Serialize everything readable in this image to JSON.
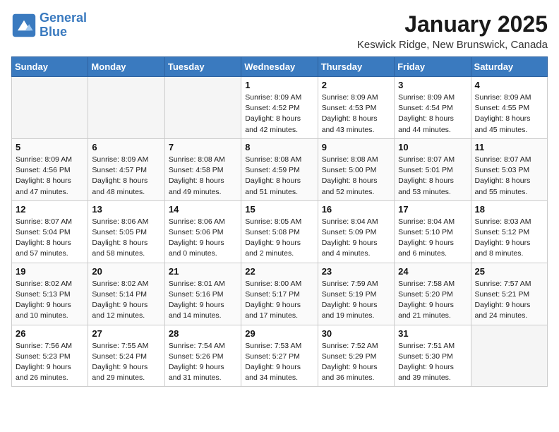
{
  "header": {
    "logo_line1": "General",
    "logo_line2": "Blue",
    "month_title": "January 2025",
    "location": "Keswick Ridge, New Brunswick, Canada"
  },
  "weekdays": [
    "Sunday",
    "Monday",
    "Tuesday",
    "Wednesday",
    "Thursday",
    "Friday",
    "Saturday"
  ],
  "weeks": [
    [
      {
        "day": "",
        "info": ""
      },
      {
        "day": "",
        "info": ""
      },
      {
        "day": "",
        "info": ""
      },
      {
        "day": "1",
        "info": "Sunrise: 8:09 AM\nSunset: 4:52 PM\nDaylight: 8 hours\nand 42 minutes."
      },
      {
        "day": "2",
        "info": "Sunrise: 8:09 AM\nSunset: 4:53 PM\nDaylight: 8 hours\nand 43 minutes."
      },
      {
        "day": "3",
        "info": "Sunrise: 8:09 AM\nSunset: 4:54 PM\nDaylight: 8 hours\nand 44 minutes."
      },
      {
        "day": "4",
        "info": "Sunrise: 8:09 AM\nSunset: 4:55 PM\nDaylight: 8 hours\nand 45 minutes."
      }
    ],
    [
      {
        "day": "5",
        "info": "Sunrise: 8:09 AM\nSunset: 4:56 PM\nDaylight: 8 hours\nand 47 minutes."
      },
      {
        "day": "6",
        "info": "Sunrise: 8:09 AM\nSunset: 4:57 PM\nDaylight: 8 hours\nand 48 minutes."
      },
      {
        "day": "7",
        "info": "Sunrise: 8:08 AM\nSunset: 4:58 PM\nDaylight: 8 hours\nand 49 minutes."
      },
      {
        "day": "8",
        "info": "Sunrise: 8:08 AM\nSunset: 4:59 PM\nDaylight: 8 hours\nand 51 minutes."
      },
      {
        "day": "9",
        "info": "Sunrise: 8:08 AM\nSunset: 5:00 PM\nDaylight: 8 hours\nand 52 minutes."
      },
      {
        "day": "10",
        "info": "Sunrise: 8:07 AM\nSunset: 5:01 PM\nDaylight: 8 hours\nand 53 minutes."
      },
      {
        "day": "11",
        "info": "Sunrise: 8:07 AM\nSunset: 5:03 PM\nDaylight: 8 hours\nand 55 minutes."
      }
    ],
    [
      {
        "day": "12",
        "info": "Sunrise: 8:07 AM\nSunset: 5:04 PM\nDaylight: 8 hours\nand 57 minutes."
      },
      {
        "day": "13",
        "info": "Sunrise: 8:06 AM\nSunset: 5:05 PM\nDaylight: 8 hours\nand 58 minutes."
      },
      {
        "day": "14",
        "info": "Sunrise: 8:06 AM\nSunset: 5:06 PM\nDaylight: 9 hours\nand 0 minutes."
      },
      {
        "day": "15",
        "info": "Sunrise: 8:05 AM\nSunset: 5:08 PM\nDaylight: 9 hours\nand 2 minutes."
      },
      {
        "day": "16",
        "info": "Sunrise: 8:04 AM\nSunset: 5:09 PM\nDaylight: 9 hours\nand 4 minutes."
      },
      {
        "day": "17",
        "info": "Sunrise: 8:04 AM\nSunset: 5:10 PM\nDaylight: 9 hours\nand 6 minutes."
      },
      {
        "day": "18",
        "info": "Sunrise: 8:03 AM\nSunset: 5:12 PM\nDaylight: 9 hours\nand 8 minutes."
      }
    ],
    [
      {
        "day": "19",
        "info": "Sunrise: 8:02 AM\nSunset: 5:13 PM\nDaylight: 9 hours\nand 10 minutes."
      },
      {
        "day": "20",
        "info": "Sunrise: 8:02 AM\nSunset: 5:14 PM\nDaylight: 9 hours\nand 12 minutes."
      },
      {
        "day": "21",
        "info": "Sunrise: 8:01 AM\nSunset: 5:16 PM\nDaylight: 9 hours\nand 14 minutes."
      },
      {
        "day": "22",
        "info": "Sunrise: 8:00 AM\nSunset: 5:17 PM\nDaylight: 9 hours\nand 17 minutes."
      },
      {
        "day": "23",
        "info": "Sunrise: 7:59 AM\nSunset: 5:19 PM\nDaylight: 9 hours\nand 19 minutes."
      },
      {
        "day": "24",
        "info": "Sunrise: 7:58 AM\nSunset: 5:20 PM\nDaylight: 9 hours\nand 21 minutes."
      },
      {
        "day": "25",
        "info": "Sunrise: 7:57 AM\nSunset: 5:21 PM\nDaylight: 9 hours\nand 24 minutes."
      }
    ],
    [
      {
        "day": "26",
        "info": "Sunrise: 7:56 AM\nSunset: 5:23 PM\nDaylight: 9 hours\nand 26 minutes."
      },
      {
        "day": "27",
        "info": "Sunrise: 7:55 AM\nSunset: 5:24 PM\nDaylight: 9 hours\nand 29 minutes."
      },
      {
        "day": "28",
        "info": "Sunrise: 7:54 AM\nSunset: 5:26 PM\nDaylight: 9 hours\nand 31 minutes."
      },
      {
        "day": "29",
        "info": "Sunrise: 7:53 AM\nSunset: 5:27 PM\nDaylight: 9 hours\nand 34 minutes."
      },
      {
        "day": "30",
        "info": "Sunrise: 7:52 AM\nSunset: 5:29 PM\nDaylight: 9 hours\nand 36 minutes."
      },
      {
        "day": "31",
        "info": "Sunrise: 7:51 AM\nSunset: 5:30 PM\nDaylight: 9 hours\nand 39 minutes."
      },
      {
        "day": "",
        "info": ""
      }
    ]
  ]
}
